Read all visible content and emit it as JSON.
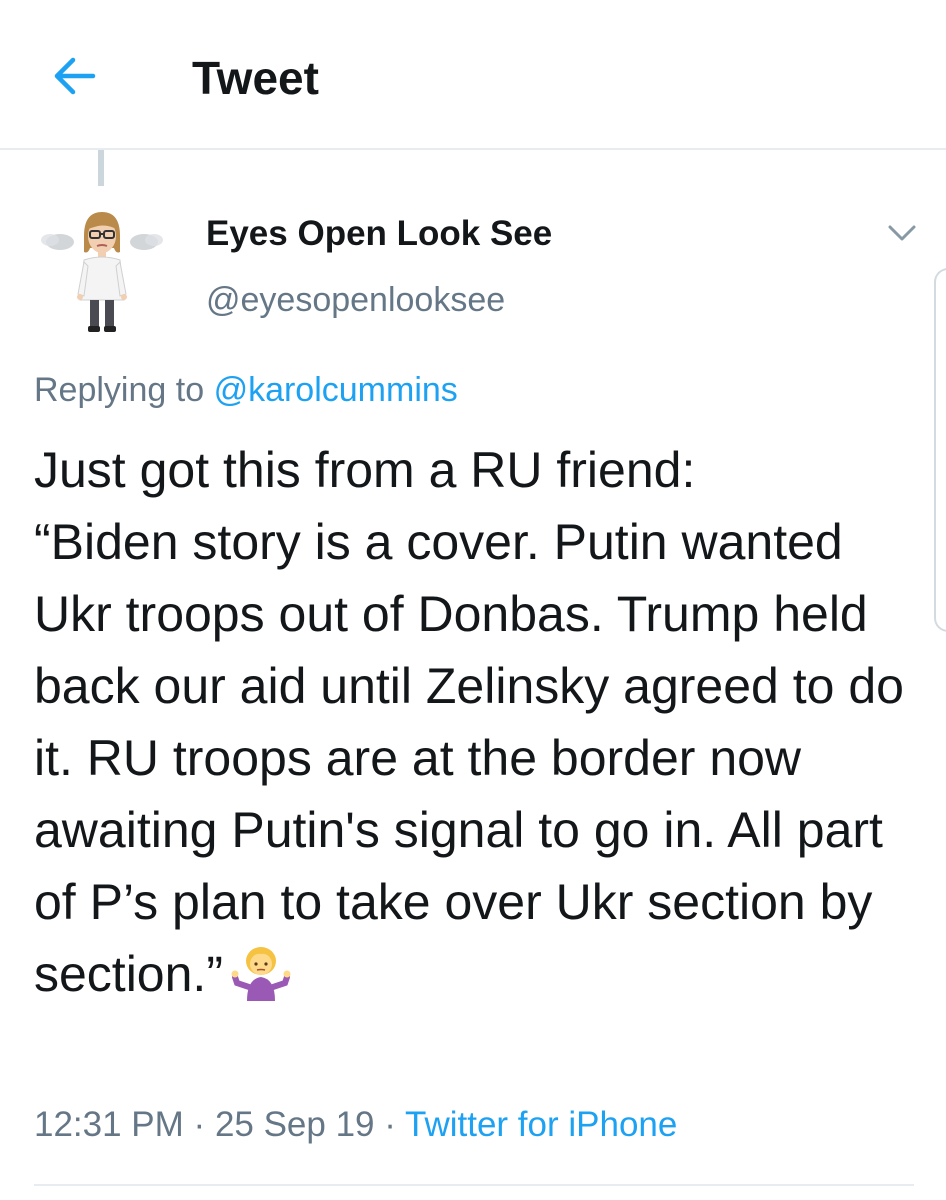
{
  "header": {
    "title": "Tweet",
    "back_icon": "arrow-left-icon",
    "accent_color": "#1da1f2"
  },
  "tweet": {
    "author": {
      "display_name": "Eyes Open Look See",
      "handle": "@eyesopenlooksee",
      "avatar": "bitmoji-avatar"
    },
    "replying_prefix": "Replying to",
    "replying_to": "@karolcummins",
    "text": "Just got this from a RU friend:\n“Biden story is a cover. Putin wanted Ukr troops out of Donbas. Trump held back our aid until Zelinsky agreed to do it. RU troops are at the border now awaiting Putin's signal to go in. All part of P’s plan to take over Ukr section by section.”",
    "emoji": "person-shrugging-emoji",
    "time": "12:31 PM",
    "separator": "·",
    "date": "25 Sep 19",
    "source": "Twitter for iPhone",
    "menu_icon": "chevron-down-icon"
  },
  "colors": {
    "text_primary": "#14171a",
    "text_secondary": "#657786",
    "link": "#1da1f2",
    "divider": "#e6ecf0"
  }
}
